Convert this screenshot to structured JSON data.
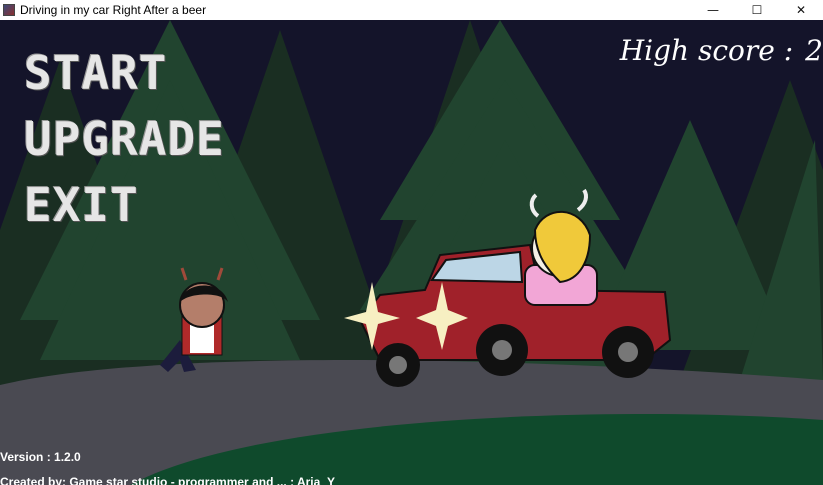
{
  "window": {
    "title": "Driving in my car Right After a beer",
    "minimize_glyph": "—",
    "maximize_glyph": "☐",
    "close_glyph": "✕"
  },
  "menu": {
    "start": "START",
    "upgrade": "UPGRADE",
    "exit": "EXIT"
  },
  "high_score": {
    "label": "High score :",
    "value": "2"
  },
  "footer": {
    "version": "Version : 1.2.0",
    "credits": "Created by: Game star studio - programmer and ... : Aria_Y"
  },
  "colors": {
    "sky": "#14142a",
    "forest": "#1f3b2a",
    "road": "#4a4a52",
    "grass": "#0f4a2c",
    "car": "#a0212a",
    "menu_text": "#e6e6e6"
  }
}
